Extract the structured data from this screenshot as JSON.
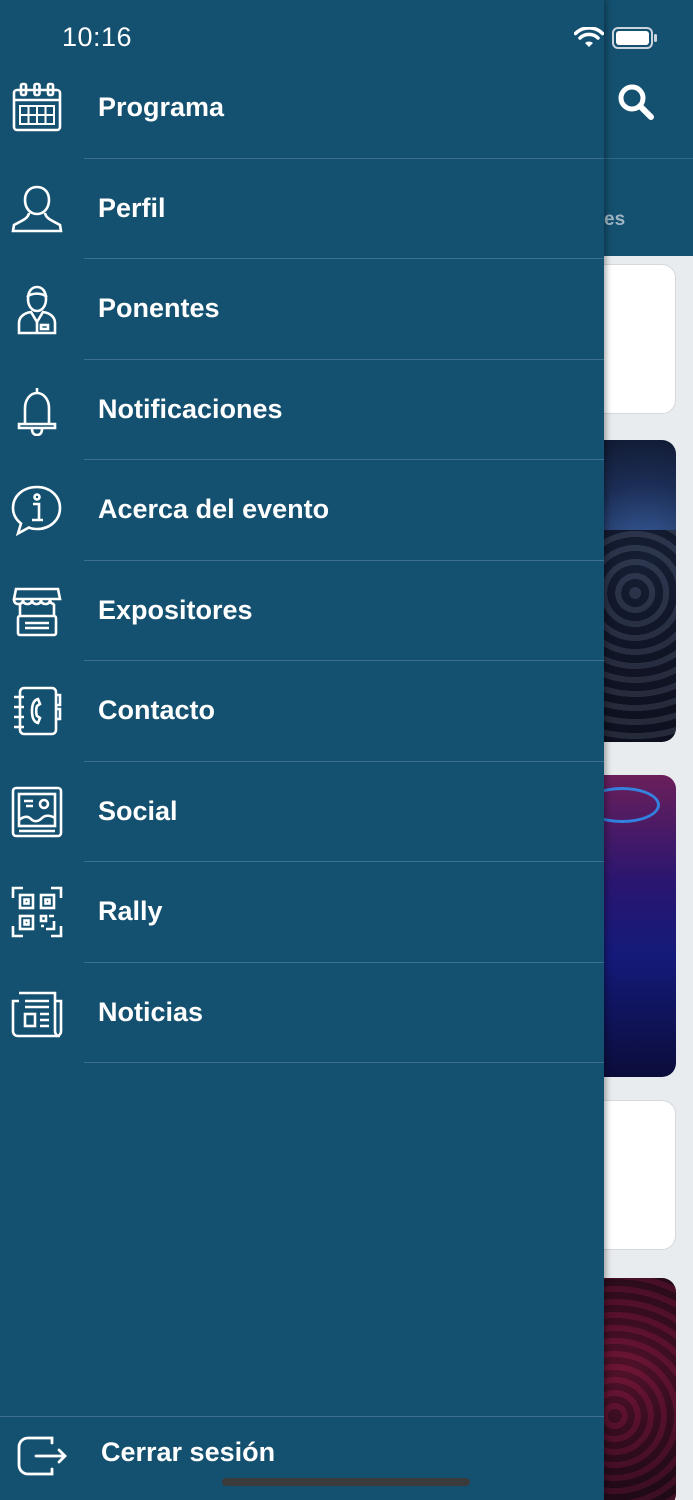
{
  "status_bar": {
    "time": "10:16"
  },
  "background": {
    "tab_fragment": "es"
  },
  "menu": {
    "items": [
      {
        "label": "Programa",
        "icon": "calendar-icon"
      },
      {
        "label": "Perfil",
        "icon": "user-icon"
      },
      {
        "label": "Ponentes",
        "icon": "speaker-icon"
      },
      {
        "label": "Notificaciones",
        "icon": "bell-icon"
      },
      {
        "label": "Acerca del evento",
        "icon": "info-icon"
      },
      {
        "label": "Expositores",
        "icon": "booth-icon"
      },
      {
        "label": "Contacto",
        "icon": "phonebook-icon"
      },
      {
        "label": "Social",
        "icon": "social-icon"
      },
      {
        "label": "Rally",
        "icon": "qr-code-icon"
      },
      {
        "label": "Noticias",
        "icon": "newspaper-icon"
      }
    ],
    "logout": {
      "label": "Cerrar sesión",
      "icon": "logout-icon"
    }
  },
  "colors": {
    "drawer_bg": "#14506f",
    "divider": "#3b6f8d",
    "text": "#ffffff"
  }
}
